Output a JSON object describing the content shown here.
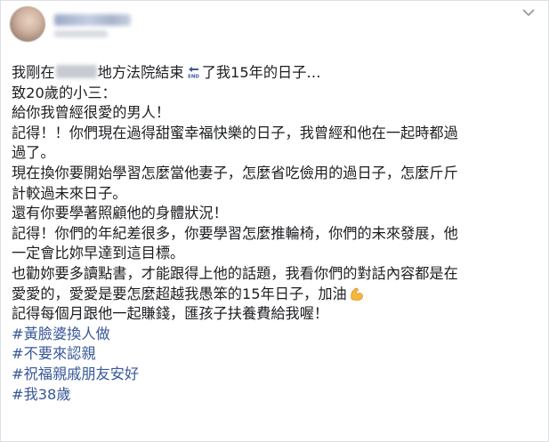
{
  "post": {
    "lines": [
      {
        "before": "我剛在",
        "after": "地方法院結束",
        "after2": "了我15年的日子…"
      },
      "致20歲的小三：",
      "給你我曾經很愛的男人！",
      "記得！！你們現在過得甜蜜幸福快樂的日子，我曾經和他在一起時都過",
      "過了。",
      "現在換你要開始學習怎麼當他妻子，怎麼省吃儉用的過日子，怎麼斤斤",
      "計較過未來日子。",
      "還有你要學著照顧他的身體狀況！",
      "記得！你們的年紀差很多，你要學習怎麼推輪椅，你們的未來發展，他",
      "一定會比妳早達到這目標。",
      "也勸妳要多讀點書，才能跟得上他的話題，我看你們的對話內容都是在",
      {
        "text": "愛愛的，愛愛是要怎麼超越我愚笨的15年日子，加油"
      },
      "記得每個月跟他一起賺錢，匯孩子扶養費給我喔！"
    ],
    "hashtags": [
      "#黃臉婆換人做",
      "#不要來認親",
      "#祝福親戚朋友安好",
      "#我38歲"
    ]
  },
  "icons": {
    "end": "end-arrow-icon",
    "arm": "flexed-biceps-icon",
    "menu": "chevron-down-icon"
  },
  "colors": {
    "text": "#1c1e21",
    "hashtag": "#385898",
    "border": "#dddfe2"
  }
}
